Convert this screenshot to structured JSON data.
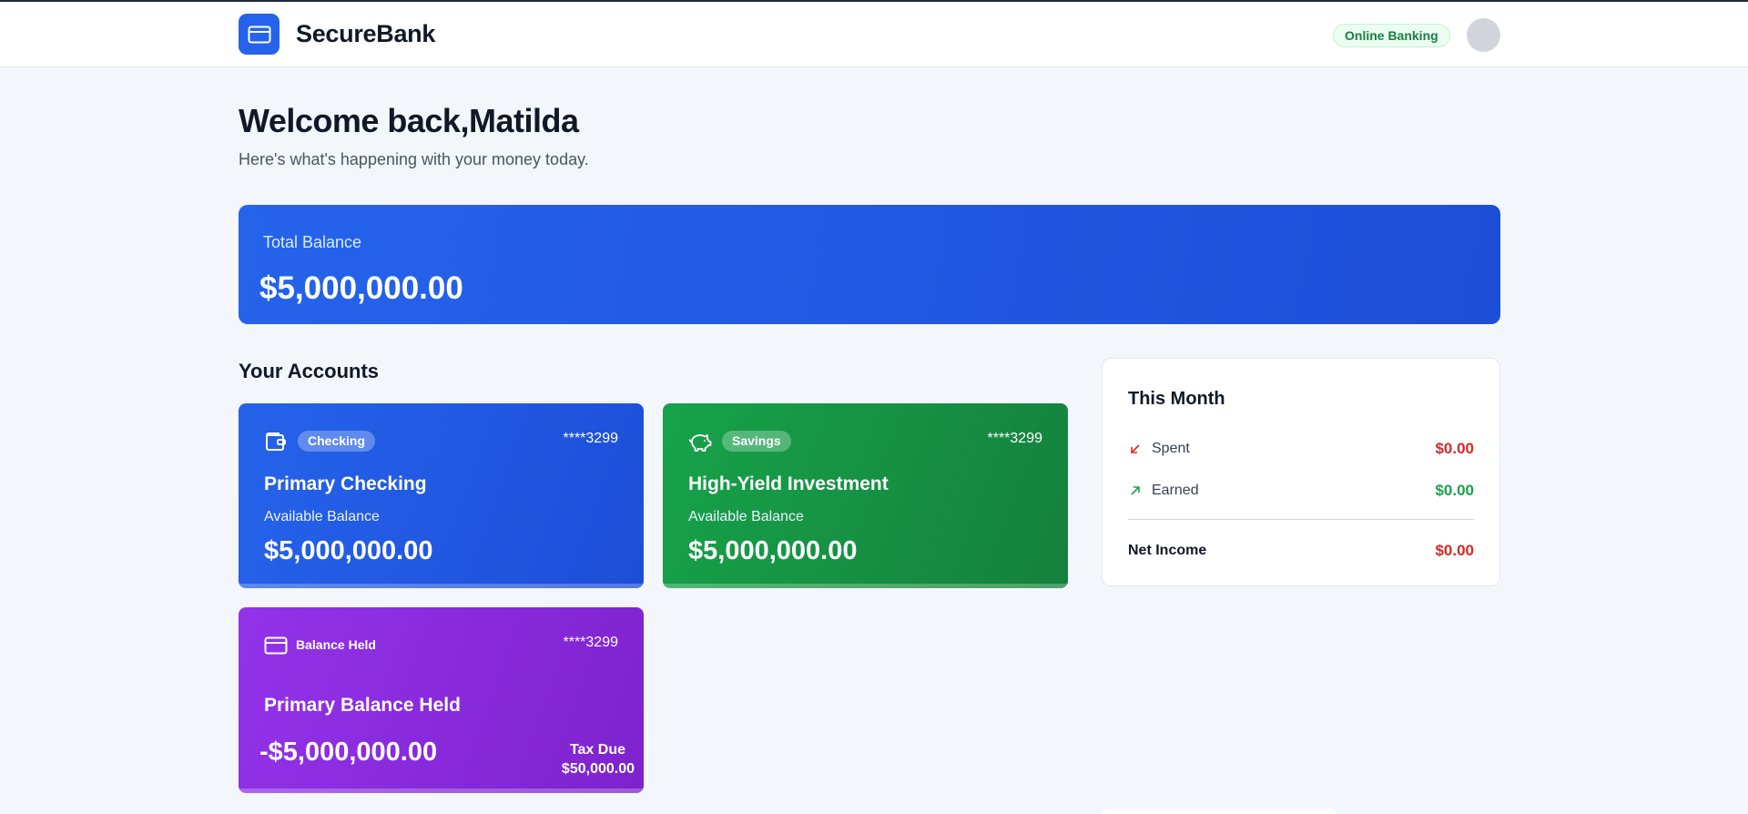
{
  "header": {
    "brand": "SecureBank",
    "badge": "Online Banking"
  },
  "welcome": {
    "title": "Welcome back,Matilda",
    "subtitle": "Here's what's happening with your money today."
  },
  "total_balance": {
    "label": "Total Balance",
    "value": "$5,000,000.00"
  },
  "accounts": {
    "section_title": "Your Accounts",
    "checking": {
      "type": "Checking",
      "number": "****3299",
      "name": "Primary Checking",
      "balance_label": "Available Balance",
      "balance": "$5,000,000.00",
      "icon": "wallet-icon",
      "color": "#2563eb"
    },
    "savings": {
      "type": "Savings",
      "number": "****3299",
      "name": "High-Yield Investment",
      "balance_label": "Available Balance",
      "balance": "$5,000,000.00",
      "icon": "piggy-bank-icon",
      "color": "#16a34a"
    },
    "held": {
      "type": "Balance Held",
      "number": "****3299",
      "name": "Primary Balance Held",
      "balance": "-$5,000,000.00",
      "tax_label": "Tax Due",
      "tax_value": "$50,000.00",
      "icon": "credit-card-icon",
      "color": "#9333ea"
    }
  },
  "this_month": {
    "title": "This Month",
    "spent_label": "Spent",
    "spent_value": "$0.00",
    "earned_label": "Earned",
    "earned_value": "$0.00",
    "net_label": "Net Income",
    "net_value": "$0.00",
    "negative_color": "#dc2626",
    "positive_color": "#16a34a"
  }
}
